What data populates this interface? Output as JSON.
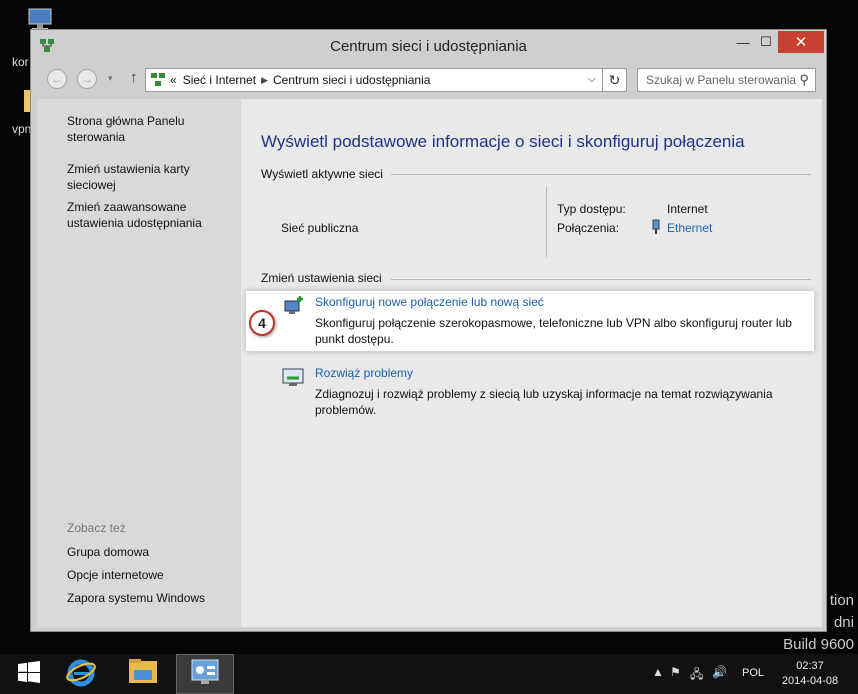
{
  "desktop": {
    "icons": [
      {
        "name": "network-computer-icon",
        "label": "kor"
      },
      {
        "name": "folder-icon",
        "label": "vpn"
      }
    ],
    "watermark": {
      "line1": "tion",
      "line2": "dni",
      "line3": "Build 9600"
    }
  },
  "window": {
    "title": "Centrum sieci i udostępniania",
    "buttons": {
      "minimize": "—",
      "maximize": "☐",
      "close": "✕"
    }
  },
  "address": {
    "prefix": "«",
    "crumbs": [
      "Sieć i Internet",
      "Centrum sieci i udostępniania"
    ],
    "search_placeholder": "Szukaj w Panelu sterowania"
  },
  "sidebar": {
    "links": [
      "Strona główna Panelu sterowania",
      "Zmień ustawienia karty sieciowej",
      "Zmień zaawansowane ustawienia udostępniania"
    ],
    "see_also_title": "Zobacz też",
    "see_also": [
      "Grupa domowa",
      "Opcje internetowe",
      "Zapora systemu Windows"
    ]
  },
  "main": {
    "heading": "Wyświetl podstawowe informacje o sieci i skonfiguruj połączenia",
    "active_networks_title": "Wyświetl aktywne sieci",
    "network_name": "Sieć publiczna",
    "access_type_label": "Typ dostępu:",
    "access_type_value": "Internet",
    "connections_label": "Połączenia:",
    "connections_value": "Ethernet",
    "change_settings_title": "Zmień ustawienia sieci",
    "tasks": [
      {
        "title": "Skonfiguruj nowe połączenie lub nową sieć",
        "desc": "Skonfiguruj połączenie szerokopasmowe, telefoniczne lub VPN albo skonfiguruj router lub punkt dostępu."
      },
      {
        "title": "Rozwiąż problemy",
        "desc": "Zdiagnozuj i rozwiąż problemy z siecią lub uzyskaj informacje na temat rozwiązywania problemów."
      }
    ],
    "step_badge": "4"
  },
  "taskbar": {
    "lang": "POL",
    "time": "02:37",
    "date": "2014-04-08"
  },
  "colors": {
    "link": "#1b5fa8",
    "heading": "#1e3287",
    "close_button": "#c74132",
    "badge_border": "#c0332b"
  }
}
